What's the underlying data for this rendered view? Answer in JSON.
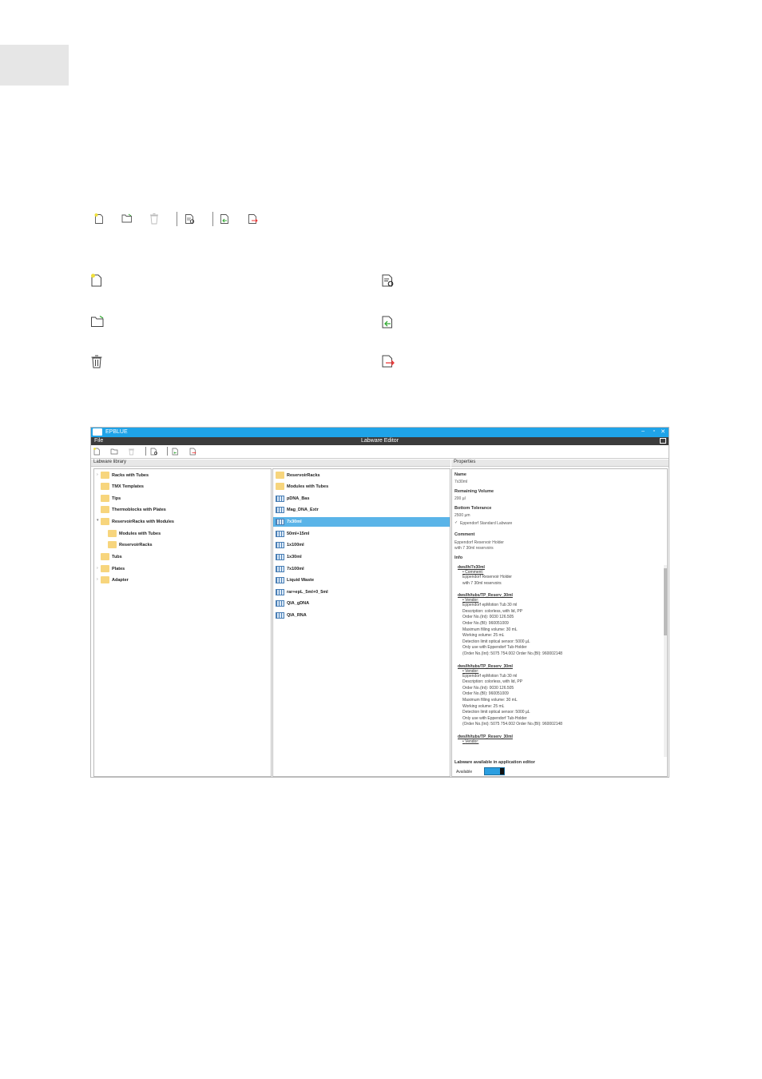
{
  "app": {
    "name": "EPBLUE",
    "menu_file": "File",
    "window_title": "Labware Editor"
  },
  "panels": {
    "library_header": "Labware library",
    "properties_header": "Properties"
  },
  "tree": [
    {
      "label": "Racks with Tubes"
    },
    {
      "label": "TMX Templates"
    },
    {
      "label": "Tips"
    },
    {
      "label": "Thermoblocks with Plates"
    },
    {
      "label": "ReservoirRacks with Modules"
    },
    {
      "label": "Modules with Tubes"
    },
    {
      "label": "ReservoirRacks"
    },
    {
      "label": "Tubs"
    },
    {
      "label": "Plates"
    },
    {
      "label": "Adapter"
    }
  ],
  "content_list": [
    {
      "label": "ReservoirRacks",
      "icon": "folder-icon"
    },
    {
      "label": "Modules with Tubes",
      "icon": "folder-icon"
    },
    {
      "label": "pDNA_Bas",
      "icon": "rack-icon"
    },
    {
      "label": "Mag_DNA_Extr",
      "icon": "rack-icon"
    },
    {
      "label": "7x30ml",
      "icon": "rack-icon",
      "selected": true
    },
    {
      "label": "50ml+15ml",
      "icon": "rack-icon"
    },
    {
      "label": "1x100ml",
      "icon": "rack-icon"
    },
    {
      "label": "1x30ml",
      "icon": "rack-icon"
    },
    {
      "label": "7x100ml",
      "icon": "rack-icon"
    },
    {
      "label": "Liquid Waste",
      "icon": "rack-icon"
    },
    {
      "label": "rar+epL_5ml+0_5ml",
      "icon": "rack-icon"
    },
    {
      "label": "QIA_gDNA",
      "icon": "rack-icon"
    },
    {
      "label": "QIA_RNA",
      "icon": "rack-icon"
    }
  ],
  "properties": {
    "name_label": "Name",
    "name_value": "7x30ml",
    "remaining_label": "Remaining Volume",
    "remaining_value": "200 µl",
    "bottom_label": "Bottom Tolerance",
    "bottom_value": "2500 µm",
    "standard_label": "Eppendorf Standard Labware",
    "comment_label": "Comment",
    "comment_line1": "Eppendorf Reservoir Holder",
    "comment_line2": "with 7 30ml reservoirs",
    "info_label": "Info",
    "info_blocks": [
      {
        "title": "dws/lh/7x30ml",
        "bullet": "Comment:",
        "lines": [
          "Eppendorf Reservoir Holder",
          "with 7 30ml reservoirs"
        ]
      },
      {
        "title": "dws/lh/tubs/TP_Reserv_30ml",
        "bullet": "Vendor:",
        "lines": [
          "Eppendorf epMotion Tub 30 ml",
          "Description: colorless, with lid, PP",
          "Order No.(Int): 0030 126.505",
          "Order No.(BI): 960051009",
          "Maximum filling volume: 30 mL",
          "Working volume: 25 mL",
          "Detection limit optical sensor: 5000 µL",
          "Only use with Eppendorf Tub-Holder",
          "(Order No.(Int): 5075 754.002  Order No.(BI): 960002148"
        ]
      },
      {
        "title": "dws/lh/tubs/TP_Reserv_30ml",
        "bullet": "Vendor:",
        "lines": [
          "Eppendorf epMotion Tub 30 ml",
          "Description: colorless, with lid, PP",
          "Order No.(Int): 0030 126.505",
          "Order No.(BI): 960051009",
          "Maximum filling volume: 30 mL",
          "Working volume: 25 mL",
          "Detection limit optical sensor: 5000 µL",
          "Only use with Eppendorf Tub-Holder",
          "(Order No.(Int): 5075 754.002  Order No.(BI): 960002148"
        ]
      },
      {
        "title": "dws/lh/tubs/TP_Reserv_30ml",
        "bullet": "Vendor:",
        "lines": []
      }
    ],
    "availability_label": "Labware available in application editor",
    "available_label": "Available"
  },
  "colors": {
    "titlebar": "#1fa3e8",
    "menubar": "#3c3c3c",
    "selection": "#5ab4e8",
    "folder": "#f7d57d"
  }
}
